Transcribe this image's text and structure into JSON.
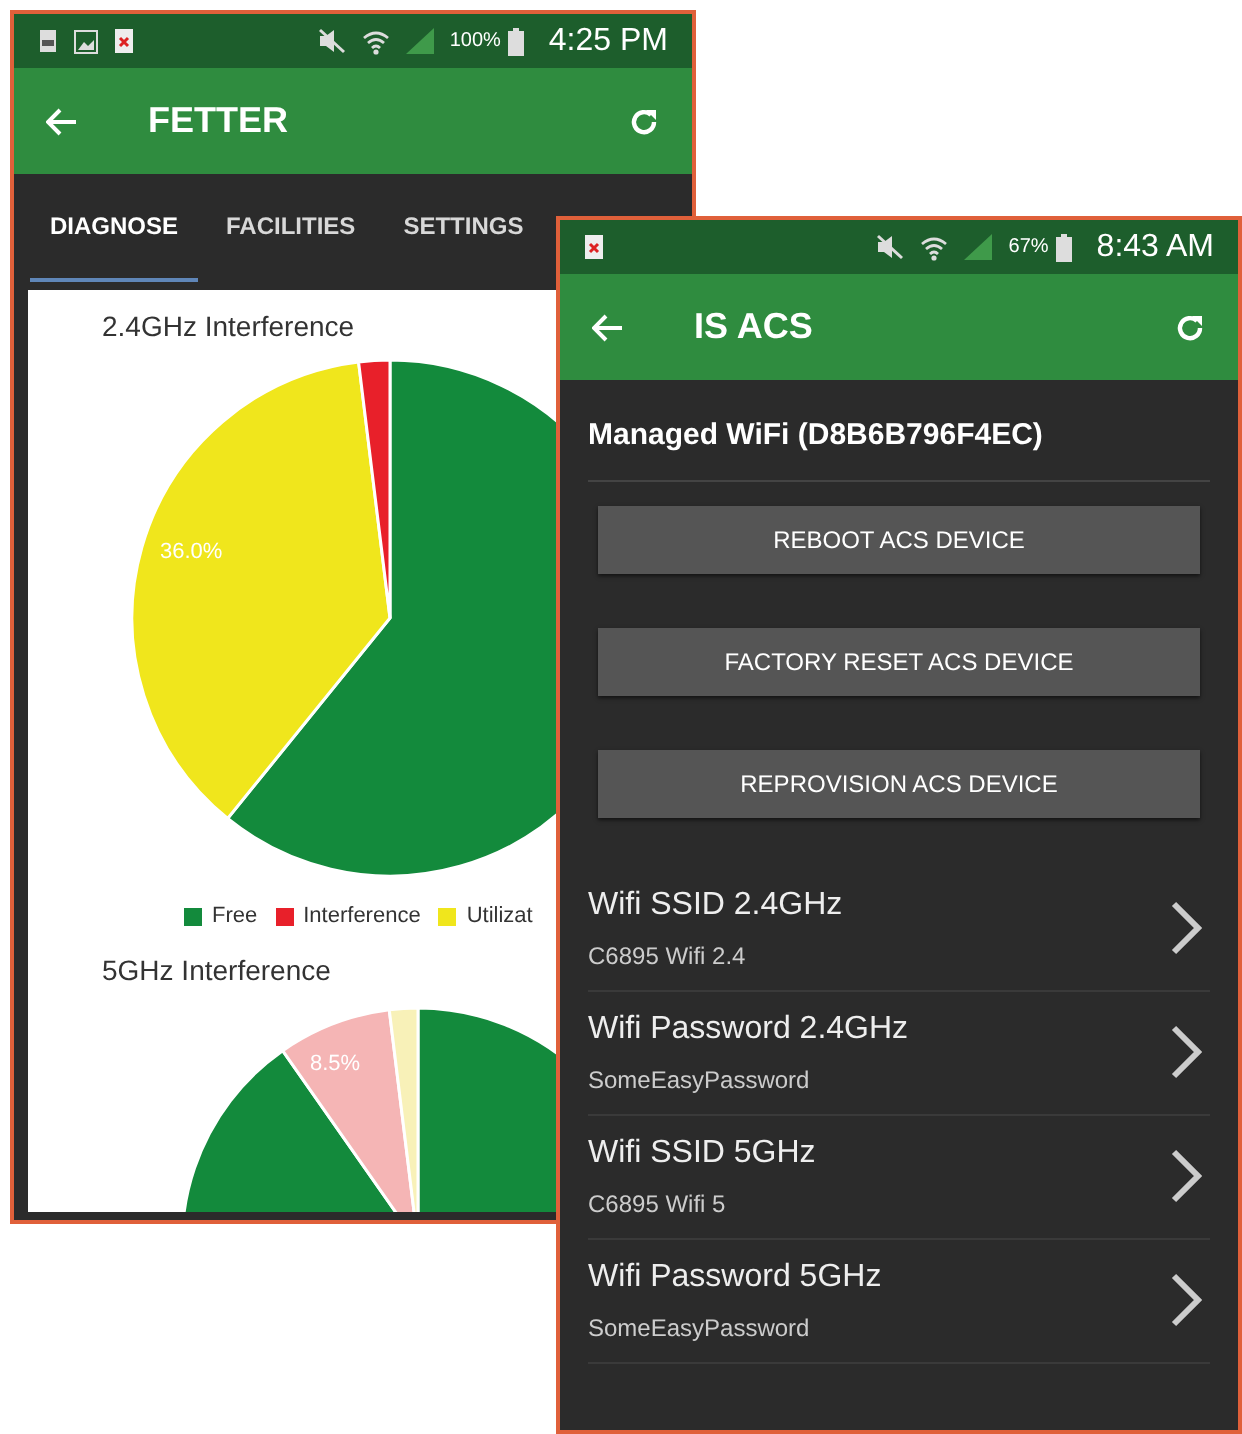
{
  "fetter_screen": {
    "status_bar": {
      "battery": "100%",
      "time": "4:25 PM"
    },
    "app_bar": {
      "title": "FETTER"
    },
    "tabs": [
      {
        "label": "DIAGNOSE",
        "selected": true
      },
      {
        "label": "FACILITIES",
        "selected": false
      },
      {
        "label": "SETTINGS",
        "selected": false
      }
    ],
    "charts": [
      {
        "title": "2.4GHz Interference",
        "slice_label": "36.0%"
      },
      {
        "title": "5GHz Interference",
        "slice_label": "8.5%"
      }
    ],
    "legend": [
      {
        "label": "Free",
        "color": "#138a3c"
      },
      {
        "label": "Interference",
        "color": "#e8202a"
      },
      {
        "label": "Utilizat",
        "color": "#f0e61c"
      }
    ]
  },
  "acs_screen": {
    "status_bar": {
      "battery": "67%",
      "time": "8:43 AM"
    },
    "app_bar": {
      "title": "IS ACS"
    },
    "heading": "Managed WiFi (D8B6B796F4EC)",
    "buttons": [
      "REBOOT ACS DEVICE",
      "FACTORY RESET ACS DEVICE",
      "REPROVISION ACS DEVICE"
    ],
    "settings": [
      {
        "title": "Wifi SSID 2.4GHz",
        "value": "C6895 Wifi 2.4"
      },
      {
        "title": "Wifi Password 2.4GHz",
        "value": "SomeEasyPassword"
      },
      {
        "title": "Wifi SSID 5GHz",
        "value": "C6895 Wifi 5"
      },
      {
        "title": "Wifi Password 5GHz",
        "value": "SomeEasyPassword"
      }
    ]
  }
}
